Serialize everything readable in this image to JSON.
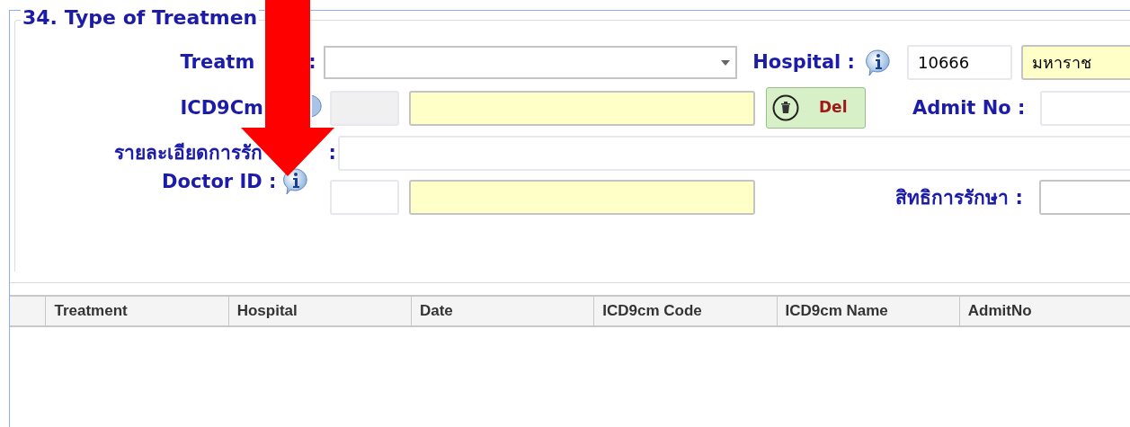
{
  "section": {
    "title": "34. Type of Treatmen"
  },
  "treatment": {
    "label_start": "Treatm",
    "label_colon": ":"
  },
  "hospital": {
    "label": "Hospital :",
    "code": "10666",
    "name": "มหาราช"
  },
  "icd9": {
    "label": "ICD9Cm"
  },
  "delete_button": {
    "label": "Del"
  },
  "admit": {
    "label": "Admit No :"
  },
  "detail": {
    "label_start": "รายละเอียดการรัก",
    "label_colon": ":"
  },
  "doctor": {
    "label": "Doctor ID :"
  },
  "rights": {
    "label": "สิทธิการรักษา :"
  },
  "table": {
    "columns": [
      "Treatment",
      "Hospital",
      "Date",
      "ICD9cm Code",
      "ICD9cm Name",
      "AdmitNo"
    ]
  }
}
